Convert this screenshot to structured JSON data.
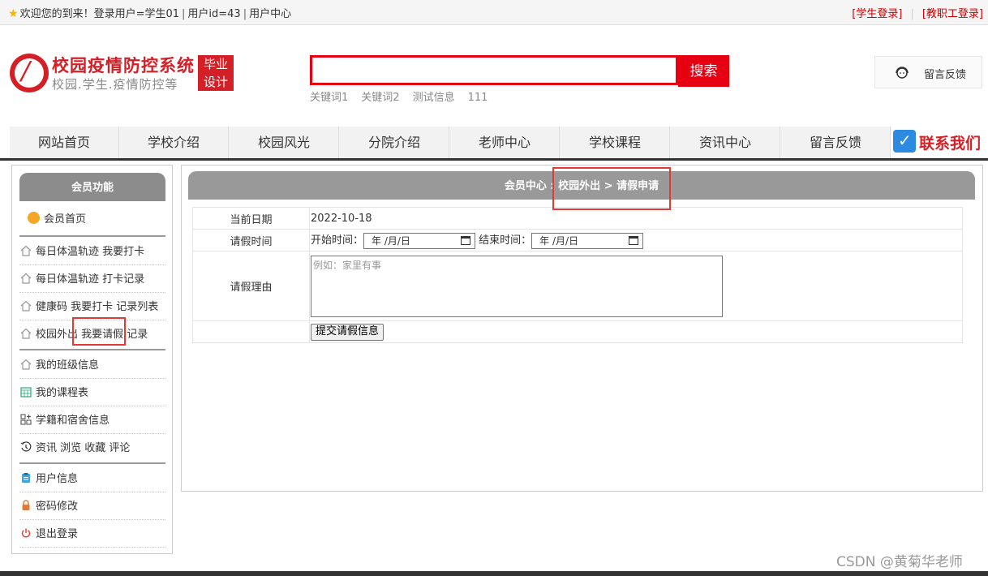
{
  "topbar": {
    "welcome": "欢迎您的到来！登录用户=学生01",
    "user_id": "用户id=43",
    "user_center": "用户中心",
    "student_login": "[学生登录]",
    "staff_login": "[教职工登录]"
  },
  "header": {
    "title": "校园疫情防控系统",
    "subtitle": "校园.学生.疫情防控等",
    "badge_line1": "毕业",
    "badge_line2": "设计",
    "search_button": "搜索",
    "search_value": "",
    "hot_words": [
      "关键词1",
      "关键词2",
      "测试信息",
      "111"
    ],
    "feedback": "留言反馈"
  },
  "nav": {
    "items": [
      "网站首页",
      "学校介绍",
      "校园风光",
      "分院介绍",
      "老师中心",
      "学校课程",
      "资讯中心",
      "留言反馈"
    ],
    "contact": "联系我们"
  },
  "sidebar": {
    "title": "会员功能",
    "home": "会员首页",
    "group1": [
      "每日体温轨迹 我要打卡",
      "每日体温轨迹 打卡记录",
      "健康码 我要打卡 记录列表",
      "校园外出 我要请假 记录"
    ],
    "group2": [
      "我的班级信息",
      "我的课程表",
      "学籍和宿舍信息",
      "资讯 浏览 收藏 评论"
    ],
    "group3": [
      "用户信息",
      "密码修改",
      "退出登录"
    ]
  },
  "main": {
    "breadcrumb": "会员中心 : 校园外出 > 请假申请",
    "date_label": "当前日期",
    "date_value": "2022-10-18",
    "time_label": "请假时间",
    "start_label": "开始时间：",
    "end_label": "结束时间：",
    "date_placeholder": "年 /月/日",
    "reason_label": "请假理由",
    "reason_placeholder": "例如：家里有事",
    "submit": "提交请假信息"
  },
  "watermark": "CSDN @黄菊华老师",
  "colors": {
    "brand_red": "#d51f26",
    "search_red": "#e60012",
    "header_gray": "#999999"
  }
}
